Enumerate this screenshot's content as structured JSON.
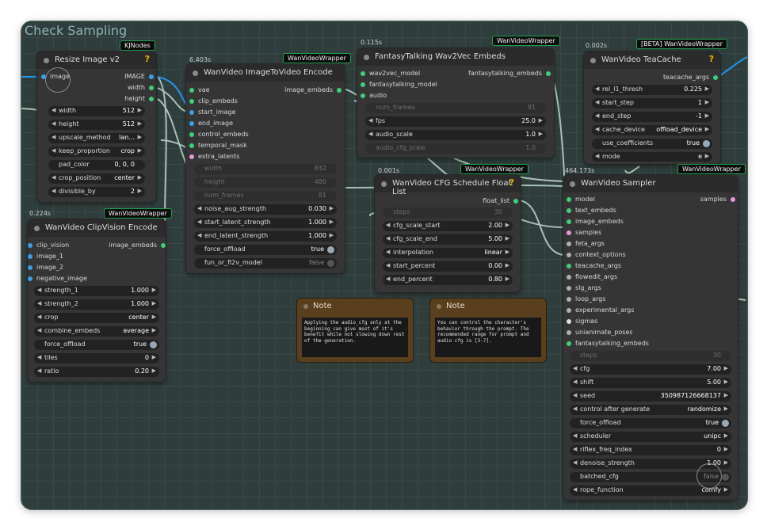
{
  "group_title": "Check Sampling",
  "colors": {
    "canvas": "#2f3d3c",
    "node": "#353535",
    "header": "#2b2b2b",
    "badge_border": "#1ea34f",
    "port_green": "#3ecf7a",
    "port_blue": "#3aa0e8",
    "port_pink": "#e89ad8",
    "port_gray": "#b0b0b0",
    "link": "#a9c2b6",
    "link_blue": "#2196f3"
  },
  "resize": {
    "badge": "KJNodes",
    "title": "Resize Image v2",
    "inputs": [
      "image"
    ],
    "outputs": [
      "IMAGE",
      "width",
      "height"
    ],
    "widgets": [
      {
        "label": "width",
        "value": "512"
      },
      {
        "label": "height",
        "value": "512"
      },
      {
        "label": "upscale_method",
        "value": "lan..."
      },
      {
        "label": "keep_proportion",
        "value": "crop"
      },
      {
        "label": "pad_color",
        "value": "0, 0, 0"
      },
      {
        "label": "crop_position",
        "value": "center"
      },
      {
        "label": "divisible_by",
        "value": "2"
      }
    ]
  },
  "i2v": {
    "timing": "6.403s",
    "badge": "WanVideoWrapper",
    "title": "WanVideo ImageToVideo Encode",
    "inputs": [
      "vae",
      "clip_embeds",
      "start_image",
      "end_image",
      "control_embeds",
      "temporal_mask",
      "extra_latents"
    ],
    "output": "image_embeds",
    "disabled": [
      {
        "label": "width",
        "value": "832"
      },
      {
        "label": "height",
        "value": "480"
      },
      {
        "label": "num_frames",
        "value": "81"
      }
    ],
    "widgets": [
      {
        "label": "noise_aug_strength",
        "value": "0.030"
      },
      {
        "label": "start_latent_strength",
        "value": "1.000"
      },
      {
        "label": "end_latent_strength",
        "value": "1.000"
      }
    ],
    "toggles": [
      {
        "label": "force_offload",
        "value": "true"
      },
      {
        "label": "fun_or_fl2v_model",
        "value": "false"
      }
    ]
  },
  "clip": {
    "timing": "0.224s",
    "badge": "WanVideoWrapper",
    "title": "WanVideo ClipVision Encode",
    "inputs": [
      "clip_vision",
      "image_1",
      "image_2",
      "negative_image"
    ],
    "output": "image_embeds",
    "widgets": [
      {
        "label": "strength_1",
        "value": "1.000"
      },
      {
        "label": "strength_2",
        "value": "1.000"
      },
      {
        "label": "crop",
        "value": "center"
      },
      {
        "label": "combine_embeds",
        "value": "average"
      }
    ],
    "toggle": {
      "label": "force_offload",
      "value": "true"
    },
    "widgets2": [
      {
        "label": "tiles",
        "value": "0"
      },
      {
        "label": "ratio",
        "value": "0.20"
      }
    ]
  },
  "ft": {
    "timing": "0.115s",
    "badge": "WanVideoWrapper",
    "title": "FantasyTalking Wav2Vec Embeds",
    "inputs": [
      "wav2vec_model",
      "fantasytalking_model",
      "audio"
    ],
    "output": "fantasytalking_embeds",
    "disabled1": {
      "label": "num_frames",
      "value": "81"
    },
    "widgets": [
      {
        "label": "fps",
        "value": "25.0"
      },
      {
        "label": "audio_scale",
        "value": "1.0"
      }
    ],
    "disabled2": {
      "label": "audio_cfg_scale",
      "value": "1.0"
    }
  },
  "teacache": {
    "timing": "0.002s",
    "badge": "[BETA] WanVideoWrapper",
    "title": "WanVideo TeaCache",
    "output": "teacache_args",
    "widgets": [
      {
        "label": "rel_l1_thresh",
        "value": "0.225"
      },
      {
        "label": "start_step",
        "value": "1"
      },
      {
        "label": "end_step",
        "value": "-1"
      },
      {
        "label": "cache_device",
        "value": "offload_device"
      }
    ],
    "toggle": {
      "label": "use_coefficients",
      "value": "true"
    },
    "widgets2": [
      {
        "label": "mode",
        "value": "e"
      }
    ]
  },
  "cfg": {
    "timing": "0.001s",
    "badge": "WanVideoWrapper",
    "title": "WanVideo CFG Schedule Float List",
    "output": "float_list",
    "disabled": {
      "label": "steps",
      "value": "30"
    },
    "widgets": [
      {
        "label": "cfg_scale_start",
        "value": "2.00"
      },
      {
        "label": "cfg_scale_end",
        "value": "5.00"
      },
      {
        "label": "interpolation",
        "value": "linear"
      },
      {
        "label": "start_percent",
        "value": "0.00"
      },
      {
        "label": "end_percent",
        "value": "0.80"
      }
    ]
  },
  "note1": {
    "title": "Note",
    "text": "Applying the audio_cfg only at the beginning can give most of it's benefit while not slowing down rest of the generation."
  },
  "note2": {
    "title": "Note",
    "text": "You can control the character's behavior through the prompt. The recommended range for prompt and audio cfg is [3-7]."
  },
  "sampler": {
    "timing": "464.173s",
    "badge": "WanVideoWrapper",
    "title": "WanVideo Sampler",
    "output": "samples",
    "inputs": [
      "model",
      "text_embeds",
      "image_embeds",
      "samples",
      "feta_args",
      "context_options",
      "teacache_args",
      "flowedit_args",
      "slg_args",
      "loop_args",
      "experimental_args",
      "sigmas",
      "unianimate_poses",
      "fantasytalking_embeds"
    ],
    "disabled": {
      "label": "steps",
      "value": "30"
    },
    "widgets": [
      {
        "label": "cfg",
        "value": "7.00"
      },
      {
        "label": "shift",
        "value": "5.00"
      },
      {
        "label": "seed",
        "value": "350987126668137"
      },
      {
        "label": "control after generate",
        "value": "randomize"
      }
    ],
    "toggle": {
      "label": "force_offload",
      "value": "true"
    },
    "widgets2": [
      {
        "label": "scheduler",
        "value": "unipc"
      },
      {
        "label": "riflex_freq_index",
        "value": "0"
      },
      {
        "label": "denoise_strength",
        "value": "1.00"
      }
    ],
    "toggle2": {
      "label": "batched_cfg",
      "value": "false"
    },
    "widgets3": [
      {
        "label": "rope_function",
        "value": "comfy"
      }
    ]
  }
}
